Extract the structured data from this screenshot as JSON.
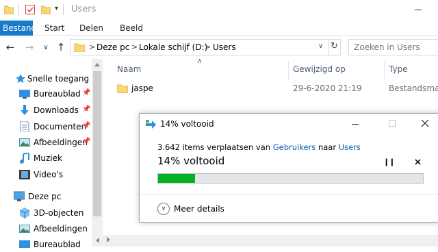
{
  "window": {
    "title": "Users"
  },
  "ribbon": {
    "tabs": [
      "Bestand",
      "Start",
      "Delen",
      "Beeld"
    ]
  },
  "address": {
    "crumbs": [
      "Deze pc",
      "Lokale schijf (D:)",
      "Users"
    ],
    "separator": ">"
  },
  "search": {
    "placeholder": "Zoeken in Users"
  },
  "sidebar": {
    "items": [
      {
        "label": "Snelle toegang",
        "icon": "star-icon",
        "pinned": false
      },
      {
        "label": "Bureaublad",
        "icon": "desktop-icon",
        "pinned": true
      },
      {
        "label": "Downloads",
        "icon": "download-icon",
        "pinned": true
      },
      {
        "label": "Documenten",
        "icon": "document-icon",
        "pinned": true
      },
      {
        "label": "Afbeeldingen",
        "icon": "pictures-icon",
        "pinned": true
      },
      {
        "label": "Muziek",
        "icon": "music-icon",
        "pinned": false
      },
      {
        "label": "Video's",
        "icon": "video-icon",
        "pinned": false
      },
      {
        "label": "Deze pc",
        "icon": "computer-icon",
        "pinned": false
      },
      {
        "label": "3D-objecten",
        "icon": "cube-icon",
        "pinned": false
      },
      {
        "label": "Afbeeldingen",
        "icon": "pictures-icon",
        "pinned": false
      },
      {
        "label": "Bureaublad",
        "icon": "desktop-icon",
        "pinned": false
      }
    ]
  },
  "columns": {
    "name": "Naam",
    "modified": "Gewijzigd op",
    "type": "Type"
  },
  "files": [
    {
      "name": "jaspe",
      "modified": "29-6-2020 21:19",
      "type": "Bestandsmap"
    }
  ],
  "dialog": {
    "title": "14% voltooid",
    "desc_prefix": "3.642 items verplaatsen van",
    "from": "Gebruikers",
    "desc_mid": "naar",
    "to": "Users",
    "status": "14% voltooid",
    "progress": 0.14,
    "more_details": "Meer details"
  },
  "colors": {
    "accent": "#1979ca",
    "progress": "#06b025",
    "link": "#0b5cad"
  }
}
